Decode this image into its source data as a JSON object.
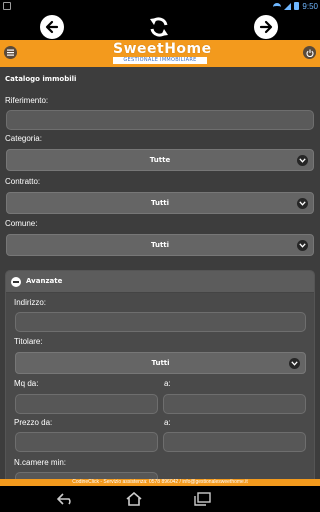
{
  "status_bar": {
    "time": "9:50"
  },
  "header": {
    "logo_main": "SweetHome",
    "logo_sub": "GESTIONALE IMMOBILIARE"
  },
  "catalog": {
    "title": "Catalogo immobili",
    "riferimento_label": "Riferimento:",
    "riferimento_value": "",
    "categoria_label": "Categoria:",
    "categoria_value": "Tutte",
    "contratto_label": "Contratto:",
    "contratto_value": "Tutti",
    "comune_label": "Comune:",
    "comune_value": "Tutti"
  },
  "advanced": {
    "title": "Avanzate",
    "indirizzo_label": "Indirizzo:",
    "titolare_label": "Titolare:",
    "titolare_value": "Tutti",
    "mq_da_label": "Mq da:",
    "mq_a_label": "a:",
    "prezzo_da_label": "Prezzo da:",
    "prezzo_a_label": "a:",
    "camere_label": "N.camere min:"
  },
  "footer": {
    "text": "CodineClick - Servizio assistenza: 0578 896042 / info@gestionalesweethome.it"
  },
  "colors": {
    "accent": "#f39a1d",
    "background": "#3d3d3d",
    "status_icons": "#6fb7ff"
  },
  "icons": {
    "nav_back": "arrow-left-icon",
    "nav_refresh": "refresh-icon",
    "nav_forward": "arrow-right-icon",
    "menu": "menu-icon",
    "power": "power-icon",
    "select": "chevron-down-icon",
    "collapse": "minus-icon"
  }
}
